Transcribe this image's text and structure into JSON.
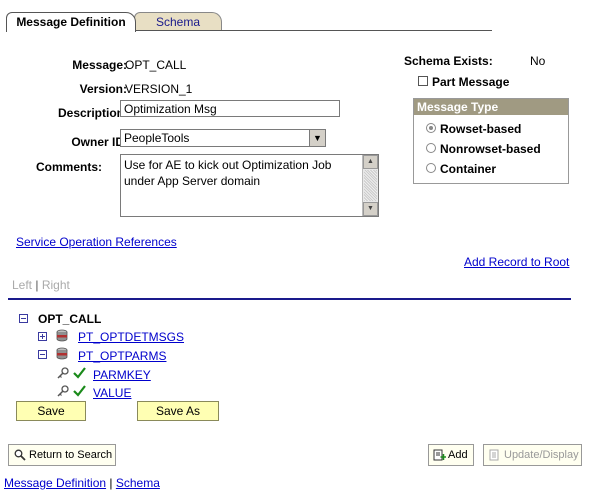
{
  "tabs": {
    "active": "Message Definition",
    "inactive": "Schema"
  },
  "form": {
    "message_label": "Message:",
    "message_value": "OPT_CALL",
    "version_label": "Version:",
    "version_value": "VERSION_1",
    "description_label": "Description:",
    "description_value": "Optimization Msg",
    "owner_label": "Owner ID:",
    "owner_value": "PeopleTools",
    "comments_label": "Comments:",
    "comments_value": "Use for AE to kick out Optimization Job\nunder App Server domain"
  },
  "schema": {
    "exists_label": "Schema Exists:",
    "exists_value": "No",
    "part_message_label": "Part Message"
  },
  "message_type": {
    "title": "Message Type",
    "options": [
      "Rowset-based",
      "Nonrowset-based",
      "Container"
    ],
    "selected": "Rowset-based"
  },
  "links": {
    "service_operation": "Service Operation References",
    "add_record": "Add Record to Root"
  },
  "side_tabs": {
    "left": "Left",
    "separator": "|",
    "right": "Right"
  },
  "tree": {
    "root": "OPT_CALL",
    "records": [
      "PT_OPTDETMSGS",
      "PT_OPTPARMS"
    ],
    "fields": [
      "PARMKEY",
      "VALUE"
    ]
  },
  "buttons": {
    "save": "Save",
    "save_as": "Save As",
    "return_to_search": "Return to Search",
    "add": "Add",
    "update_display": "Update/Display"
  },
  "footer": {
    "message_definition": "Message Definition",
    "separator": "|",
    "schema": "Schema"
  },
  "colors": {
    "link": "#0000cc",
    "button_yellow": "#ffffb3",
    "group_header": "#a09a82",
    "rule": "#1a1a8c"
  }
}
